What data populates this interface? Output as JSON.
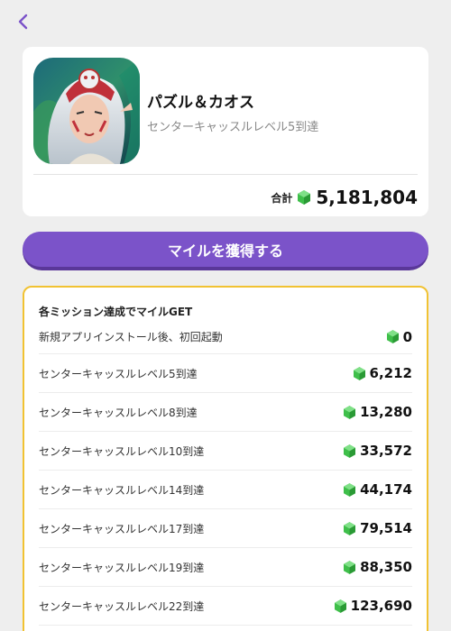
{
  "header": {
    "back_icon": "chevron-left-icon",
    "accent_color": "#7b53c9"
  },
  "app": {
    "name": "パズル＆カオス",
    "subtitle": "センターキャッスルレベル5到達",
    "total_label": "合計",
    "total_value": "5,181,804"
  },
  "cta": {
    "label": "マイルを獲得する"
  },
  "missions": {
    "heading": "各ミッション達成でマイルGET",
    "items": [
      {
        "label": "新規アプリインストール後、初回起動",
        "value": "0"
      },
      {
        "label": "センターキャッスルレベル5到達",
        "value": "6,212"
      },
      {
        "label": "センターキャッスルレベル8到達",
        "value": "13,280"
      },
      {
        "label": "センターキャッスルレベル10到達",
        "value": "33,572"
      },
      {
        "label": "センターキャッスルレベル14到達",
        "value": "44,174"
      },
      {
        "label": "センターキャッスルレベル17到達",
        "value": "79,514"
      },
      {
        "label": "センターキャッスルレベル19到達",
        "value": "88,350"
      },
      {
        "label": "センターキャッスルレベル22到達",
        "value": "123,690"
      }
    ]
  },
  "colors": {
    "gem": "#3fbf4a",
    "card_border": "#f1c232",
    "button": "#7b53c9"
  }
}
